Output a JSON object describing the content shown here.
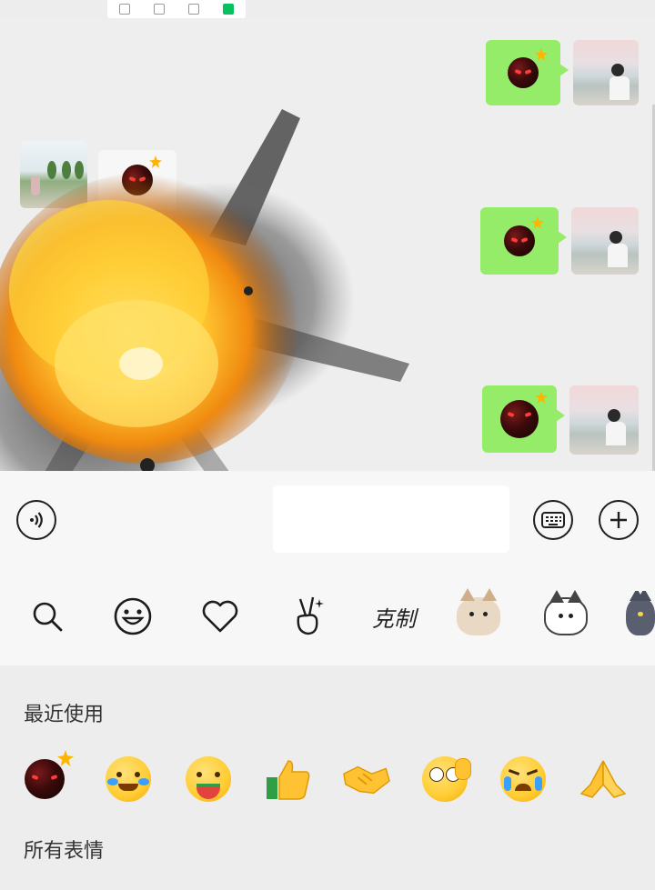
{
  "colors": {
    "bubble_green": "#95ec69",
    "chat_background": "#eeeeee",
    "panel_background": "#ededed",
    "input_bar_background": "#f7f7f7",
    "explosion_core": "#ffcc33",
    "explosion_smoke": "#3a3a3a"
  },
  "top_tabs": {
    "icons": [
      "chat-tab-icon",
      "contacts-tab-icon",
      "discover-tab-icon",
      "me-tab-icon"
    ],
    "active_index": 3
  },
  "chat": {
    "outgoing_messages": [
      {
        "content": "bomb-sticker"
      },
      {
        "content": "bomb-sticker"
      },
      {
        "content": "bomb-sticker"
      }
    ],
    "incoming_messages": [
      {
        "content": "bomb-sticker"
      }
    ],
    "effect": "explosion-animation"
  },
  "input_bar": {
    "voice_icon": "voice-icon",
    "keyboard_icon": "keyboard-icon",
    "more_icon": "plus-icon",
    "text_value": ""
  },
  "emoji_tabs": {
    "items": [
      {
        "icon": "search-icon"
      },
      {
        "icon": "smiley-icon"
      },
      {
        "icon": "heart-icon"
      },
      {
        "icon": "victory-hand-icon"
      },
      {
        "label": "克制"
      },
      {
        "icon": "tabby-cat-sticker-icon"
      },
      {
        "icon": "white-cat-sticker-icon"
      },
      {
        "icon": "grey-cat-sticker-icon"
      }
    ]
  },
  "emoji_panel": {
    "recent_title": "最近使用",
    "all_title": "所有表情",
    "recent_emojis": [
      "bomb-emoji",
      "facepalm-laugh-emoji",
      "eating-melon-emoji",
      "thumbs-up-emoji",
      "handshake-emoji",
      "thinking-emoji",
      "crying-emoji",
      "praying-hands-emoji"
    ]
  }
}
